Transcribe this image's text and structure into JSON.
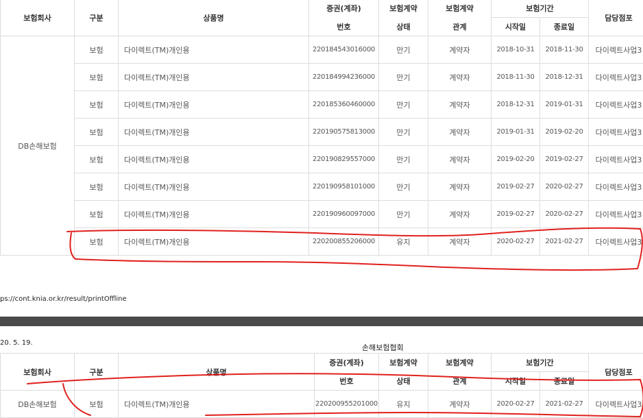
{
  "headers": {
    "insurer": "보험회사",
    "category": "구분",
    "product": "상품명",
    "cert_no_l1": "증권(계좌)",
    "cert_no_l2": "번호",
    "status_l1": "보험계약",
    "status_l2": "상태",
    "relation_l1": "보험계약",
    "relation_l2": "관계",
    "period": "보험기간",
    "start": "시작일",
    "end": "종료일",
    "branch": "담당점포"
  },
  "page1": {
    "insurer_name": "DB손해보험",
    "rows": [
      {
        "category": "보험",
        "product": "다이렉트(TM)개인용",
        "cert_no": "220184543016000",
        "status": "만기",
        "relation": "계약자",
        "start": "2018-10-31",
        "end": "2018-11-30",
        "branch": "다이렉트사업3"
      },
      {
        "category": "보험",
        "product": "다이렉트(TM)개인용",
        "cert_no": "220184994236000",
        "status": "만기",
        "relation": "계약자",
        "start": "2018-11-30",
        "end": "2018-12-31",
        "branch": "다이렉트사업3"
      },
      {
        "category": "보험",
        "product": "다이렉트(TM)개인용",
        "cert_no": "220185360460000",
        "status": "만기",
        "relation": "계약자",
        "start": "2018-12-31",
        "end": "2019-01-31",
        "branch": "다이렉트사업3"
      },
      {
        "category": "보험",
        "product": "다이렉트(TM)개인용",
        "cert_no": "220190575813000",
        "status": "만기",
        "relation": "계약자",
        "start": "2019-01-31",
        "end": "2019-02-20",
        "branch": "다이렉트사업3"
      },
      {
        "category": "보험",
        "product": "다이렉트(TM)개인용",
        "cert_no": "220190829557000",
        "status": "만기",
        "relation": "계약자",
        "start": "2019-02-20",
        "end": "2019-02-27",
        "branch": "다이렉트사업3"
      },
      {
        "category": "보험",
        "product": "다이렉트(TM)개인용",
        "cert_no": "220190958101000",
        "status": "만기",
        "relation": "계약자",
        "start": "2019-02-27",
        "end": "2020-02-27",
        "branch": "다이렉트사업3"
      },
      {
        "category": "보험",
        "product": "다이렉트(TM)개인용",
        "cert_no": "220190960097000",
        "status": "만기",
        "relation": "계약자",
        "start": "2019-02-27",
        "end": "2020-02-27",
        "branch": "다이렉트사업3"
      },
      {
        "category": "보험",
        "product": "다이렉트(TM)개인용",
        "cert_no": "220200855206000",
        "status": "유지",
        "relation": "계약자",
        "start": "2020-02-27",
        "end": "2021-02-27",
        "branch": "다이렉트사업3"
      }
    ]
  },
  "footer_url": "ps://cont.knia.or.kr/result/printOffline",
  "page2": {
    "date": "20. 5. 19.",
    "org": "손해보험협회",
    "row": {
      "insurer": "DB손해보험",
      "category": "보험",
      "product": "다이렉트(TM)개인용",
      "cert_no": "220200955201000",
      "status": "유지",
      "relation": "계약자",
      "start": "2020-02-27",
      "end": "2021-02-27",
      "branch": "다이렉트사업3"
    }
  },
  "colors": {
    "annotation": "#e0201c",
    "gap_bar": "#4a4a4a",
    "border": "#dcdcdc"
  }
}
